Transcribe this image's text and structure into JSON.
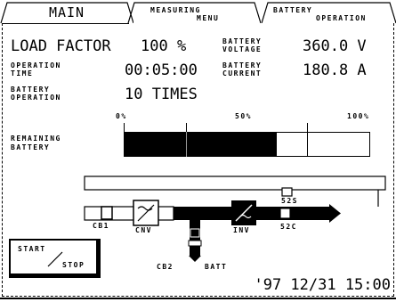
{
  "tabs": {
    "main": "MAIN",
    "measuring_menu_1": "MEASURING",
    "measuring_menu_2": "MENU",
    "battery_operation_1": "BATTERY",
    "battery_operation_2": "OPERATION"
  },
  "readings": {
    "load_factor_label": "LOAD FACTOR",
    "load_factor_value": "100 %",
    "battery_voltage_label_1": "BATTERY",
    "battery_voltage_label_2": "VOLTAGE",
    "battery_voltage_value": "360.0 V",
    "operation_time_label_1": "OPERATION",
    "operation_time_label_2": "TIME",
    "operation_time_value": "00:05:00",
    "battery_current_label_1": "BATTERY",
    "battery_current_label_2": "CURRENT",
    "battery_current_value": "180.8 A",
    "battery_operation_label_1": "BATTERY",
    "battery_operation_label_2": "OPERATION",
    "battery_operation_value": "10 TIMES"
  },
  "remaining_battery": {
    "label_1": "REMAINING",
    "label_2": "BATTERY",
    "scale_0": "0%",
    "scale_50": "50%",
    "scale_100": "100%",
    "level_fraction": 0.62
  },
  "diagram": {
    "cb1": "CB1",
    "cnv": "CNV",
    "inv": "INV",
    "s2s": "52S",
    "s2c": "52C",
    "cb2": "CB2",
    "batt": "BATT"
  },
  "button": {
    "start": "START",
    "stop": "STOP"
  },
  "datetime": "'97 12/31 15:00"
}
